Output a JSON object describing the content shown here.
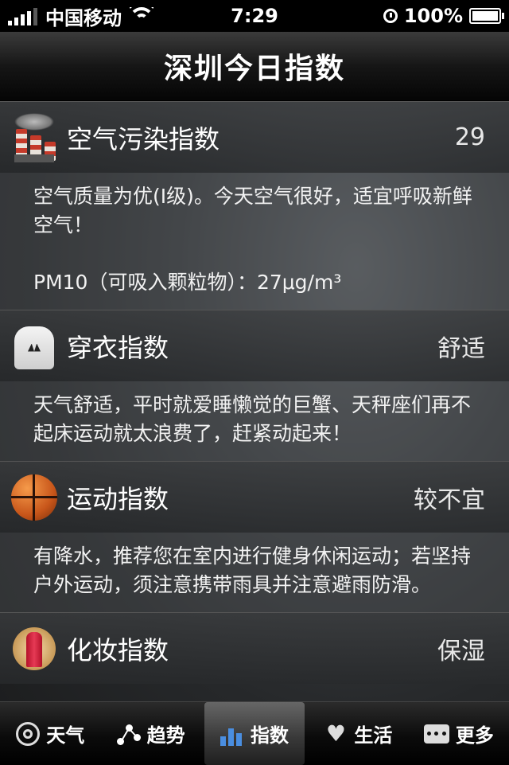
{
  "status_bar": {
    "carrier": "中国移动",
    "time": "7:29",
    "battery": "100%"
  },
  "nav": {
    "title": "深圳今日指数"
  },
  "sections": [
    {
      "title": "空气污染指数",
      "value": "29",
      "icon": "factory-icon",
      "body": [
        "空气质量为优(I级)。今天空气很好，适宜呼吸新鲜空气！",
        "PM10（可吸入颗粒物）：27μg/m³"
      ]
    },
    {
      "title": "穿衣指数",
      "value": "舒适",
      "icon": "hoodie-icon",
      "body": [
        "天气舒适，平时就爱睡懒觉的巨蟹、天秤座们再不起床运动就太浪费了，赶紧动起来！"
      ]
    },
    {
      "title": "运动指数",
      "value": "较不宜",
      "icon": "basketball-icon",
      "body": [
        "有降水，推荐您在室内进行健身休闲运动；若坚持户外运动，须注意携带雨具并注意避雨防滑。"
      ]
    },
    {
      "title": "化妆指数",
      "value": "保湿",
      "icon": "lipstick-icon"
    }
  ],
  "tabs": [
    {
      "label": "天气",
      "icon": "weather-icon"
    },
    {
      "label": "趋势",
      "icon": "trend-icon"
    },
    {
      "label": "指数",
      "icon": "index-bars-icon",
      "active": true
    },
    {
      "label": "生活",
      "icon": "heart-icon"
    },
    {
      "label": "更多",
      "icon": "more-icon"
    }
  ],
  "colors": {
    "accent_blue": "#4a8ee0"
  }
}
